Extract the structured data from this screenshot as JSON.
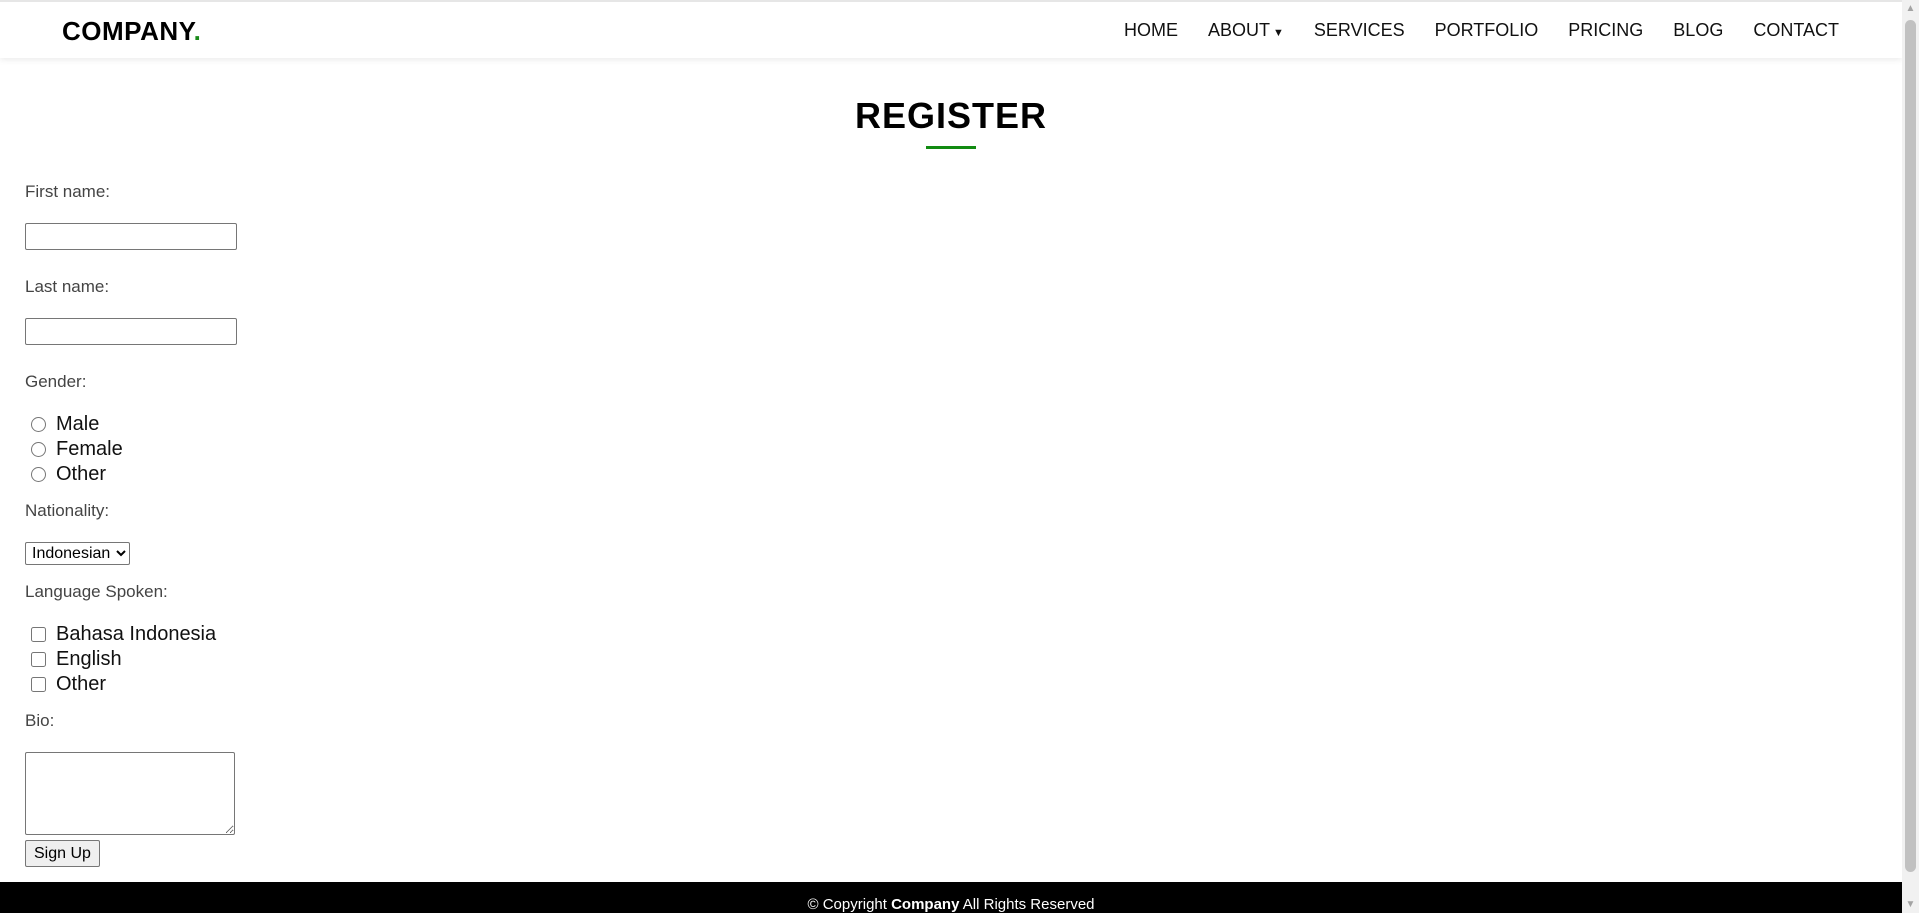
{
  "header": {
    "logo_text": "COMPANY",
    "logo_dot": ".",
    "nav": {
      "home": "HOME",
      "about": "ABOUT",
      "services": "SERVICES",
      "portfolio": "PORTFOLIO",
      "pricing": "PRICING",
      "blog": "BLOG",
      "contact": "CONTACT"
    }
  },
  "page": {
    "title": "REGISTER"
  },
  "form": {
    "first_name_label": "First name:",
    "first_name_value": "",
    "last_name_label": "Last name:",
    "last_name_value": "",
    "gender_label": "Gender:",
    "gender_options": [
      "Male",
      "Female",
      "Other"
    ],
    "nationality_label": "Nationality:",
    "nationality_selected": "Indonesian",
    "language_label": "Language Spoken:",
    "language_options": [
      "Bahasa Indonesia",
      "English",
      "Other"
    ],
    "bio_label": "Bio:",
    "bio_value": "",
    "submit_label": "Sign Up"
  },
  "footer": {
    "copyright_prefix": "© Copyright",
    "company": "Company",
    "rights": "All Rights Reserved"
  },
  "colors": {
    "accent": "#118b11",
    "footer_bg": "#000000"
  },
  "icons": {
    "about_caret": "caret-down-icon",
    "scroll_up": "scroll-up-arrow-icon",
    "scroll_down": "scroll-down-arrow-icon"
  }
}
